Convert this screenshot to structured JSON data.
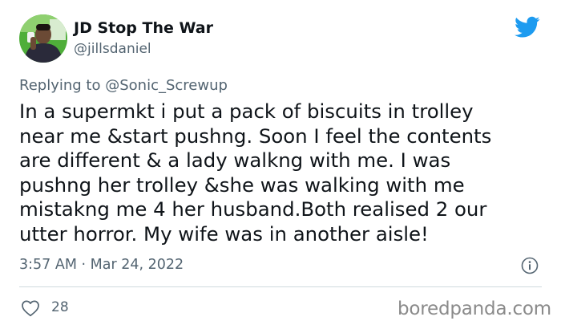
{
  "author": {
    "display_name": "JD Stop The War",
    "handle": "@jillsdaniel"
  },
  "reply": {
    "prefix": "Replying to",
    "mention": "@Sonic_Screwup"
  },
  "tweet": {
    "lines": [
      "In a supermkt i put a pack of biscuits in trolley",
      "near me &start pushng. Soon I feel the contents",
      "are different & a lady walkng with me. I was",
      "pushng her trolley &she was walking with me",
      "mistakng me 4 her husband.Both realised 2 our",
      "utter horror. My wife was in another aisle!"
    ],
    "timestamp": "3:57 AM · Mar 24, 2022"
  },
  "engagement": {
    "likes": "28"
  },
  "watermark": "boredpanda.com",
  "icons": {
    "brand": "twitter-bird-icon",
    "info": "info-icon",
    "like": "heart-icon"
  },
  "colors": {
    "text_primary": "#0f1419",
    "text_secondary": "#536471",
    "twitter_blue": "#1d9bf0",
    "divider": "#cfd9de"
  }
}
